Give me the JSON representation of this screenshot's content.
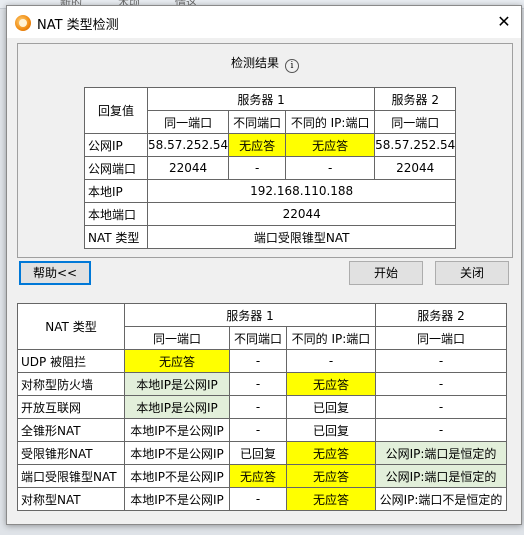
{
  "background": {
    "tab1": "新的",
    "tab2": "木顷",
    "tab3": "情这"
  },
  "dialog": {
    "title": "NAT 类型检测",
    "close": "✕"
  },
  "result": {
    "title": "检测结果",
    "header": {
      "reply": "回复值",
      "server1": "服务器 1",
      "server2": "服务器 2"
    },
    "subheader": {
      "same_port": "同一端口",
      "diff_port": "不同端口",
      "diff_ip_port": "不同的 IP:端口",
      "same_port2": "同一端口"
    },
    "rows": {
      "public_ip": {
        "label": "公网IP",
        "v1": "58.57.252.54",
        "v2": "无应答",
        "v3": "无应答",
        "v4": "58.57.252.54"
      },
      "public_port": {
        "label": "公网端口",
        "v1": "22044",
        "v2": "-",
        "v3": "-",
        "v4": "22044"
      },
      "local_ip": {
        "label": "本地IP",
        "value": "192.168.110.188"
      },
      "local_port": {
        "label": "本地端口",
        "value": "22044"
      },
      "nat_type": {
        "label": "NAT 类型",
        "value": "端口受限锥型NAT"
      }
    }
  },
  "buttons": {
    "help": "帮助<<",
    "start": "开始",
    "close": "关闭"
  },
  "reference": {
    "header": {
      "nat_type": "NAT 类型",
      "server1": "服务器 1",
      "server2": "服务器 2"
    },
    "subheader": {
      "same_port": "同一端口",
      "diff_port": "不同端口",
      "diff_ip_port": "不同的 IP:端口",
      "same_port2": "同一端口"
    },
    "rows": [
      {
        "label": "UDP 被阻拦",
        "c1": "无应答",
        "c2": "-",
        "c3": "-",
        "c4": "-"
      },
      {
        "label": "对称型防火墙",
        "c1": "本地IP是公网IP",
        "c2": "-",
        "c3": "无应答",
        "c4": "-"
      },
      {
        "label": "开放互联网",
        "c1": "本地IP是公网IP",
        "c2": "-",
        "c3": "已回复",
        "c4": "-"
      },
      {
        "label": "全锥形NAT",
        "c1": "本地IP不是公网IP",
        "c2": "-",
        "c3": "已回复",
        "c4": "-"
      },
      {
        "label": "受限锥形NAT",
        "c1": "本地IP不是公网IP",
        "c2": "已回复",
        "c3": "无应答",
        "c4": "公网IP:端口是恒定的"
      },
      {
        "label": "端口受限锥型NAT",
        "c1": "本地IP不是公网IP",
        "c2": "无应答",
        "c3": "无应答",
        "c4": "公网IP:端口是恒定的"
      },
      {
        "label": "对称型NAT",
        "c1": "本地IP不是公网IP",
        "c2": "-",
        "c3": "无应答",
        "c4": "公网IP:端口不是恒定的"
      }
    ]
  },
  "colors": {
    "highlight_yellow": "#ffff00",
    "highlight_green": "#e2efda",
    "focus_blue": "#0078d7"
  }
}
